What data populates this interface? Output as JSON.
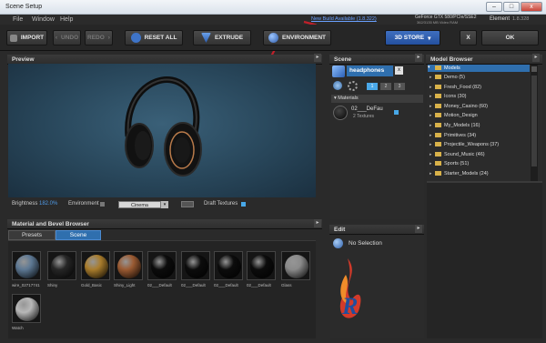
{
  "window": {
    "title": "Scene Setup",
    "minimize": "–",
    "maximize": "□",
    "close": "x"
  },
  "menu": [
    "File",
    "Window",
    "Help"
  ],
  "top_info": {
    "update_link": "New Build Available (1.8.322)",
    "gpu": "GeForce GTX 580/PCIe/SSE2",
    "gpu_sub": "362/3135 MB Video RAM",
    "product": "Element",
    "version": "1.8.328"
  },
  "toolbar": {
    "import": "IMPORT",
    "undo": "UNDO",
    "redo": "REDO",
    "reset_all": "RESET ALL",
    "extrude": "EXTRUDE",
    "environment": "ENVIRONMENT",
    "store": "3D STORE",
    "store_caret": "▾",
    "x": "X",
    "ok": "OK"
  },
  "preview": {
    "title": "Preview",
    "brightness_label": "Brightness",
    "brightness_value": "182.0%",
    "environment_label": "Environment",
    "environment_value": "Cinema",
    "draft_label": "Draft Textures"
  },
  "scene": {
    "title": "Scene",
    "object_name": "headphones",
    "close": "x",
    "tab_numbers": [
      "1",
      "2",
      "3"
    ],
    "materials_label": "Materials",
    "material_name": "02___DeFau",
    "material_sub": "2 Textures"
  },
  "model_browser": {
    "title": "Model Browser",
    "root": "Models",
    "items": [
      "Demo (5)",
      "Fresh_Food (82)",
      "Icons (30)",
      "Money_Casino (60)",
      "Motion_Design",
      "My_Models (16)",
      "Primitives (34)",
      "Projectile_Weapons (37)",
      "Sound_Music (46)",
      "Sports (51)",
      "Starter_Models (24)"
    ]
  },
  "edit": {
    "title": "Edit",
    "no_selection": "No Selection"
  },
  "material_browser": {
    "title": "Material and Bevel Browser",
    "tabs": [
      "Presets",
      "Scene"
    ],
    "items": [
      {
        "label": "wire_02717741",
        "color": "#5d7893"
      },
      {
        "label": "Shiny",
        "color": "#262626"
      },
      {
        "label": "Gold_Basic",
        "color": "#a87c2c"
      },
      {
        "label": "Shiny_Light",
        "color": "#9a5a32"
      },
      {
        "label": "02___Default",
        "color": "#0c0c0c"
      },
      {
        "label": "02___Default",
        "color": "#0c0c0c"
      },
      {
        "label": "02___Default",
        "color": "#0c0c0c"
      },
      {
        "label": "02___Default",
        "color": "#0c0c0c"
      },
      {
        "label": "Glass",
        "color": "#8a8a8a"
      },
      {
        "label": "Watch",
        "color": "#b8b8b8"
      }
    ]
  },
  "watermark": "R"
}
